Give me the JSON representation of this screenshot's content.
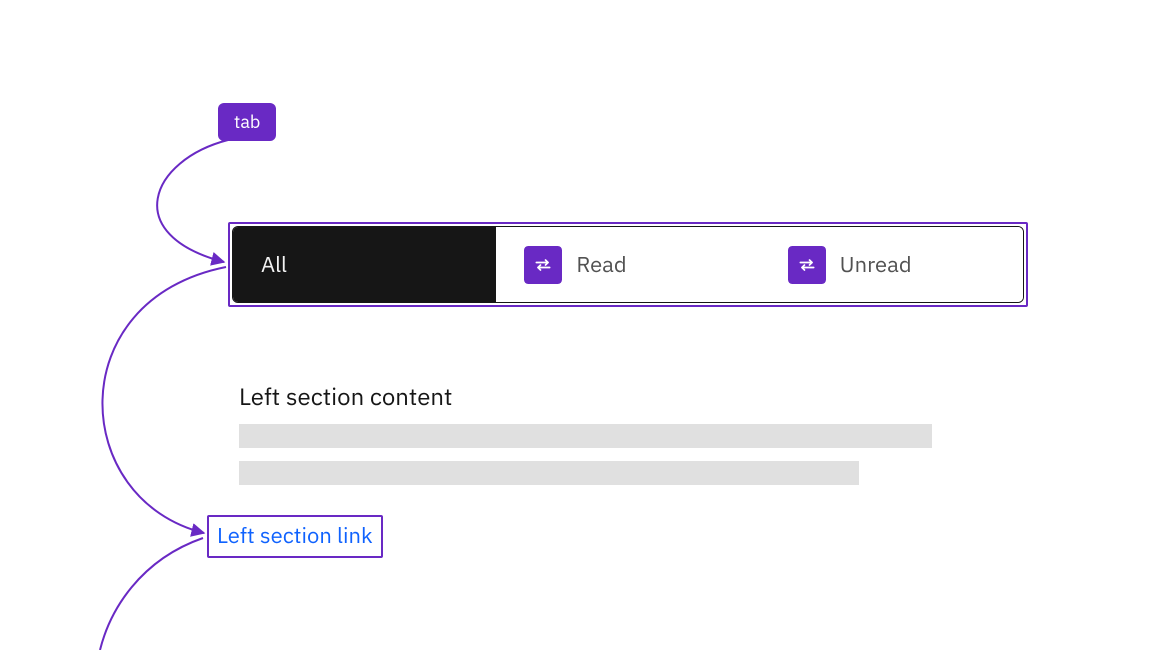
{
  "annotations": {
    "tab_label": "tab"
  },
  "tabs": {
    "items": [
      {
        "label": "All",
        "selected": true,
        "swap": false
      },
      {
        "label": "Read",
        "selected": false,
        "swap": true
      },
      {
        "label": "Unread",
        "selected": false,
        "swap": true
      }
    ]
  },
  "section": {
    "heading": "Left section content",
    "link_label": "Left section link"
  },
  "colors": {
    "accent": "#6929c4",
    "link": "#0f62fe",
    "text_primary": "#161616",
    "text_secondary": "#525252",
    "skeleton": "#e0e0e0"
  }
}
